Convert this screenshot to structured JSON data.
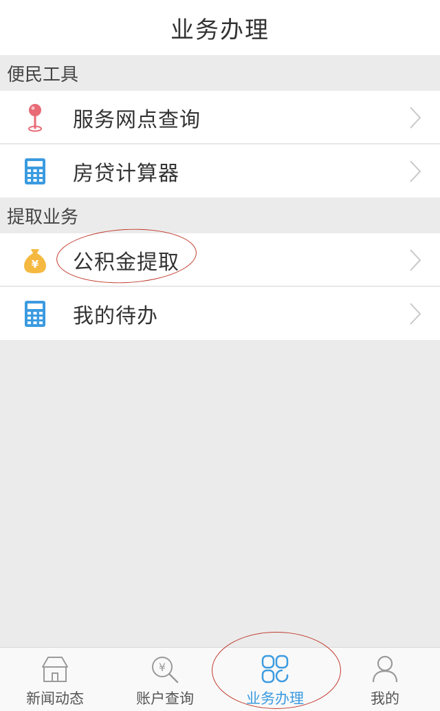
{
  "header": {
    "title": "业务办理"
  },
  "sections": [
    {
      "title": "便民工具",
      "items": [
        {
          "label": "服务网点查询",
          "icon": "location-pin-icon"
        },
        {
          "label": "房贷计算器",
          "icon": "calculator-icon"
        }
      ]
    },
    {
      "title": "提取业务",
      "items": [
        {
          "label": "公积金提取",
          "icon": "money-bag-icon"
        },
        {
          "label": "我的待办",
          "icon": "calculator-icon"
        }
      ]
    }
  ],
  "tabbar": {
    "active_index": 2,
    "tabs": [
      {
        "label": "新闻动态",
        "icon": "home-icon"
      },
      {
        "label": "账户查询",
        "icon": "yen-search-icon"
      },
      {
        "label": "业务办理",
        "icon": "grid-apps-icon"
      },
      {
        "label": "我的",
        "icon": "person-icon"
      }
    ]
  },
  "colors": {
    "accent": "#3b9be0",
    "pin": "#e86a75",
    "calculator": "#3b9be0",
    "money_bag": "#f5b942",
    "annotation": "#c0392b",
    "background": "#ebebeb"
  }
}
